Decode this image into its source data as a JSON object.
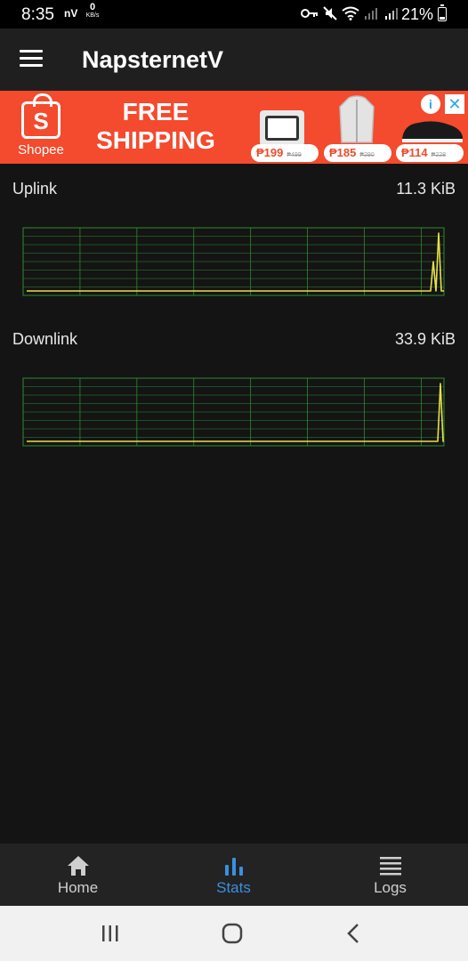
{
  "status_bar": {
    "time": "8:35",
    "nv": "nV",
    "speed_value": "0",
    "speed_unit": "KB/s",
    "battery": "21%",
    "battery_level": 0.21
  },
  "app_bar": {
    "title": "NapsternetV"
  },
  "ad": {
    "brand": "Shopee",
    "headline_line1": "FREE",
    "headline_line2": "SHIPPING",
    "prices": [
      {
        "price": "₱199",
        "old": "₱499"
      },
      {
        "price": "₱185",
        "old": "₱290"
      },
      {
        "price": "₱114",
        "old": "₱228"
      }
    ]
  },
  "stats": {
    "uplink": {
      "label": "Uplink",
      "value": "11.3 KiB"
    },
    "downlink": {
      "label": "Downlink",
      "value": "33.9 KiB"
    }
  },
  "bottom_nav": {
    "items": [
      {
        "label": "Home",
        "icon": "home-icon"
      },
      {
        "label": "Stats",
        "icon": "bar-chart-icon"
      },
      {
        "label": "Logs",
        "icon": "list-icon"
      }
    ],
    "active": "Stats"
  },
  "colors": {
    "accent": "#3b8fe0",
    "graph_grid": "#2f8a2f",
    "graph_line": "#e6e04a",
    "ad_background": "#f44a2e"
  }
}
